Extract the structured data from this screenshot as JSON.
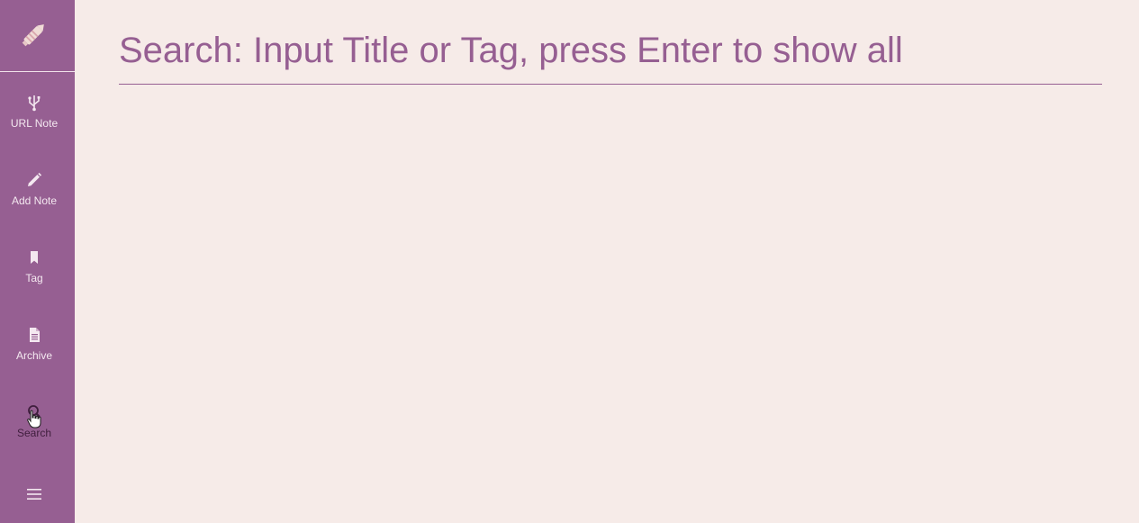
{
  "sidebar": {
    "logo_icon": "pen-logo-icon",
    "items": [
      {
        "label": "URL Note",
        "icon": "usb-icon"
      },
      {
        "label": "Add Note",
        "icon": "pencil-icon"
      },
      {
        "label": "Tag",
        "icon": "bookmark-icon"
      },
      {
        "label": "Archive",
        "icon": "document-icon"
      },
      {
        "label": "Search",
        "icon": "search-icon",
        "active": true
      }
    ],
    "menu_icon": "hamburger-menu-icon"
  },
  "main": {
    "search": {
      "placeholder": "Search: Input Title or Tag, press Enter to show all",
      "value": ""
    }
  },
  "colors": {
    "sidebar_bg": "#965f92",
    "page_bg": "#f6ebe8",
    "accent": "#965f92",
    "sidebar_text": "#f4e8f0",
    "active_text": "#3f1e3d"
  }
}
